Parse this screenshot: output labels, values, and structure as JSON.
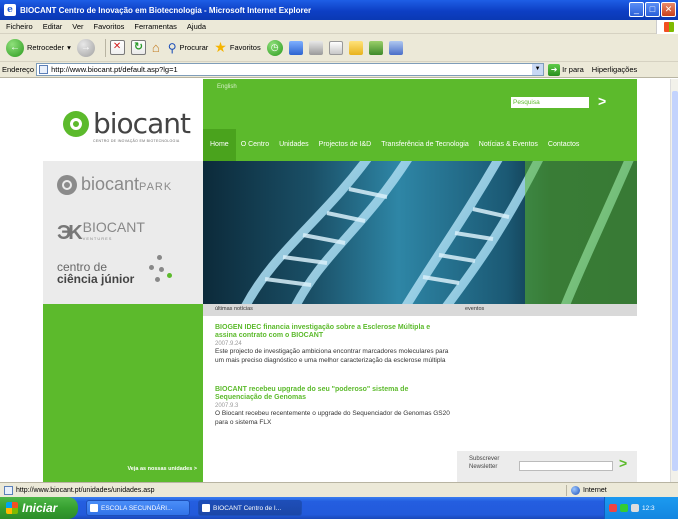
{
  "window": {
    "title": "BIOCANT Centro de Inovação em Biotecnologia - Microsoft Internet Explorer",
    "app_icon": "e",
    "buttons": [
      "_",
      "□",
      "✕"
    ]
  },
  "menu": [
    "Ficheiro",
    "Editar",
    "Ver",
    "Favoritos",
    "Ferramentas",
    "Ajuda"
  ],
  "toolbar": {
    "back_label": "Retroceder",
    "search_label": "Procurar",
    "favorites_label": "Favoritos"
  },
  "address": {
    "label": "Endereço",
    "url": "http://www.biocant.pt/default.asp?lg=1",
    "go_label": "Ir para",
    "links_label": "Hiperligações"
  },
  "site": {
    "brand_word": "biocant",
    "brand_tagline": "CENTRO DE INOVAÇÃO EM BIOTECNOLOGIA",
    "park_word": "biocant",
    "park_suffix": "PARK",
    "ventures_word": "BIOCANT",
    "ventures_sub": "VENTURES",
    "cienc_line1": "centro de",
    "cienc_line2": "ciência júnior",
    "green_link": "Veja as nossas unidades >",
    "language": "English",
    "search_placeholder": "Pesquisa",
    "nav": [
      "Home",
      "O Centro",
      "Unidades",
      "Projectos de I&D",
      "Transferência de Tecnologia",
      "Notícias & Eventos",
      "Contactos"
    ],
    "news_header": "últimas notícias",
    "events_header": "eventos",
    "news": [
      {
        "title": "BIOGEN IDEC financia investigação sobre a Esclerose Múltipla e assina contrato com o BIOCANT",
        "date": "2007.9.24",
        "body": "Este projecto de investigação ambiciona encontrar marcadores moleculares para um mais preciso diagnóstico e uma melhor caracterização da esclerose múltipla"
      },
      {
        "title": "BIOCANT recebeu upgrade do seu \"poderoso\" sistema de Sequenciação de Genomas",
        "date": "2007.9.3",
        "body": "O Biocant recebeu recentemente o upgrade do Sequenciador de Genomas GS20 para o sistema FLX"
      }
    ],
    "newsletter_line1": "Subscrever",
    "newsletter_line2": "Newsletter"
  },
  "status": {
    "url": "http://www.biocant.pt/unidades/unidades.asp",
    "zone": "Internet"
  },
  "taskbar": {
    "start": "Iniciar",
    "tasks": [
      "ESCOLA SECUNDÁRI...",
      "BIOCANT Centro de I..."
    ],
    "clock": "12:3"
  },
  "colors": {
    "brand_green": "#5cba2c",
    "xp_blue": "#245ee0"
  }
}
